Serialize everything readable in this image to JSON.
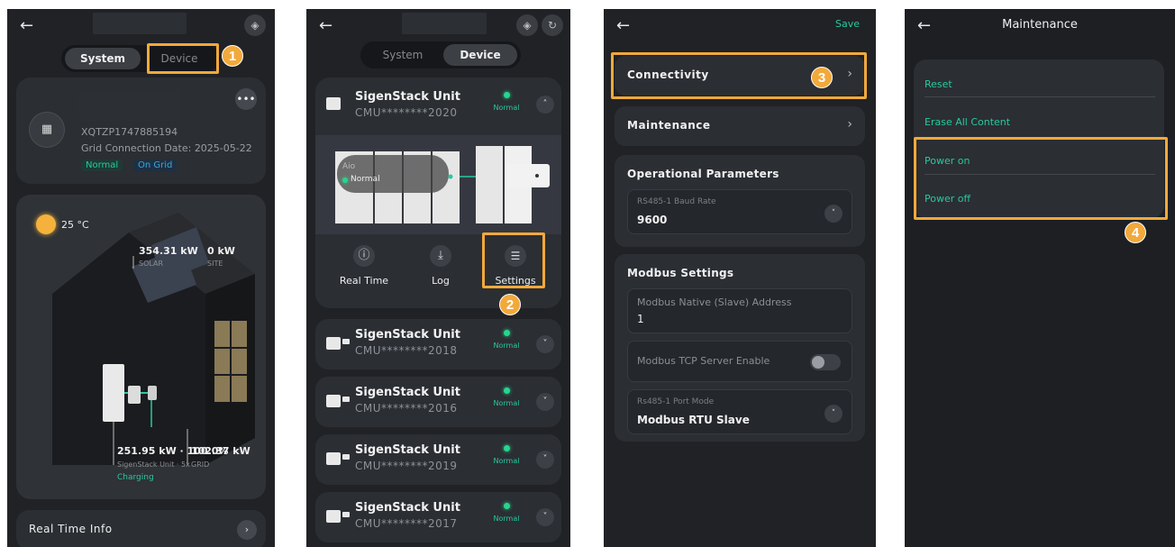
{
  "screen1": {
    "tabs": [
      "System",
      "Device"
    ],
    "station": {
      "serial": "XQTZP1747885194",
      "grid_date": "Grid Connection Date: 2025-05-22",
      "status_normal": "Normal",
      "status_grid": "On Grid"
    },
    "weather": {
      "temp": "25 °C"
    },
    "flows": {
      "solar_value": "354.31 kW",
      "solar_label": "SOLAR",
      "site_value": "0 kW",
      "site_label": "SITE",
      "battery_value": "251.95 kW · 100.0%",
      "battery_label": "SigenStack Unit · 5x",
      "battery_state": "Charging",
      "grid_value": "102.37 kW",
      "grid_label": "GRID"
    },
    "real_time_info": "Real Time Info",
    "callout_number": "1"
  },
  "screen2": {
    "tabs": [
      "System",
      "Device"
    ],
    "expanded_unit": {
      "name": "SigenStack Unit",
      "sn": "CMU********2020",
      "status": "Normal",
      "aio_label": "Aio",
      "aio_status": "Normal",
      "actions": [
        {
          "label": "Real Time",
          "icon": "info-icon",
          "glyph": "ⓘ"
        },
        {
          "label": "Log",
          "icon": "download-icon",
          "glyph": "⤓"
        },
        {
          "label": "Settings",
          "icon": "sliders-icon",
          "glyph": "☰"
        }
      ]
    },
    "units": [
      {
        "name": "SigenStack Unit",
        "sn": "CMU********2018",
        "status": "Normal"
      },
      {
        "name": "SigenStack Unit",
        "sn": "CMU********2016",
        "status": "Normal"
      },
      {
        "name": "SigenStack Unit",
        "sn": "CMU********2019",
        "status": "Normal"
      },
      {
        "name": "SigenStack Unit",
        "sn": "CMU********2017",
        "status": "Normal"
      }
    ],
    "callout_number": "2"
  },
  "screen3": {
    "save": "Save",
    "connectivity": "Connectivity",
    "maintenance": "Maintenance",
    "op_params": {
      "title": "Operational Parameters",
      "baud_label": "RS485-1 Baud Rate",
      "baud_value": "9600"
    },
    "modbus": {
      "title": "Modbus Settings",
      "address_label": "Modbus Native (Slave) Address",
      "address_value": "1",
      "tcp_label": "Modbus TCP Server Enable",
      "port_mode_label": "Rs485-1 Port Mode",
      "port_mode_value": "Modbus RTU Slave"
    },
    "callout_number": "3"
  },
  "screen4": {
    "title": "Maintenance",
    "items": [
      "Reset",
      "Erase All Content",
      "Power on",
      "Power off"
    ],
    "callout_number": "4"
  },
  "colors": {
    "accent_green": "#27c9a0",
    "callout_orange": "#f2a93b",
    "background": "#202226"
  }
}
